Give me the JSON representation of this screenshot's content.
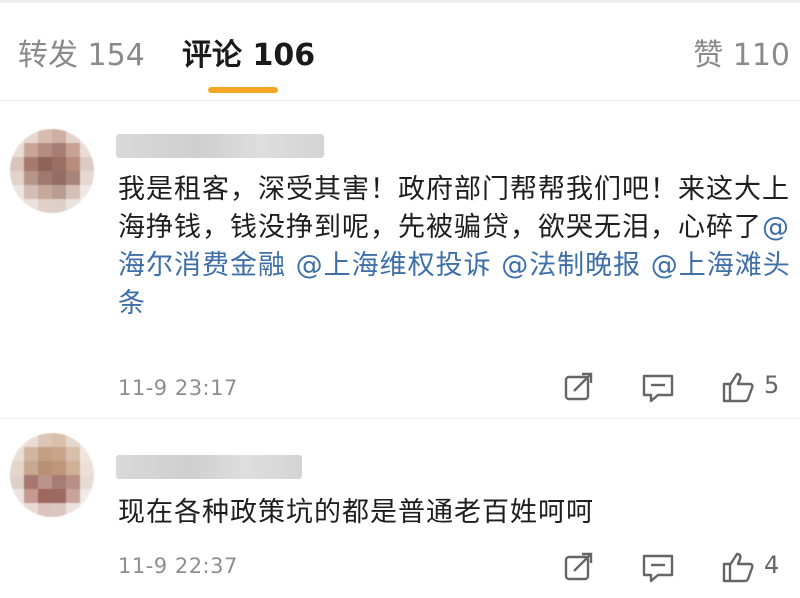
{
  "tabs": {
    "repost_label": "转发",
    "repost_count": "154",
    "comment_label": "评论",
    "comment_count": "106",
    "like_label": "赞",
    "like_count": "110"
  },
  "colors": {
    "accent": "#f5a623",
    "mention": "#3f6fa8",
    "muted": "#8e8e8e"
  },
  "comments": [
    {
      "text_plain_1": "我是租客，深受其害！政府部门帮帮我们吧！来这大上海挣钱，钱没挣到呢，先被骗贷，欲哭无泪，心碎了",
      "mentions": [
        "@海尔消费金融",
        "@上海维权投诉",
        "@法制晚报",
        "@上海滩头条"
      ],
      "timestamp": "11-9 23:17",
      "likes": "5",
      "icons": [
        "share-icon",
        "reply-icon",
        "like-icon"
      ]
    },
    {
      "text": "现在各种政策坑的都是普通老百姓呵呵",
      "timestamp": "11-9 22:37",
      "likes": "4",
      "icons": [
        "share-icon",
        "reply-icon",
        "like-icon"
      ]
    }
  ]
}
